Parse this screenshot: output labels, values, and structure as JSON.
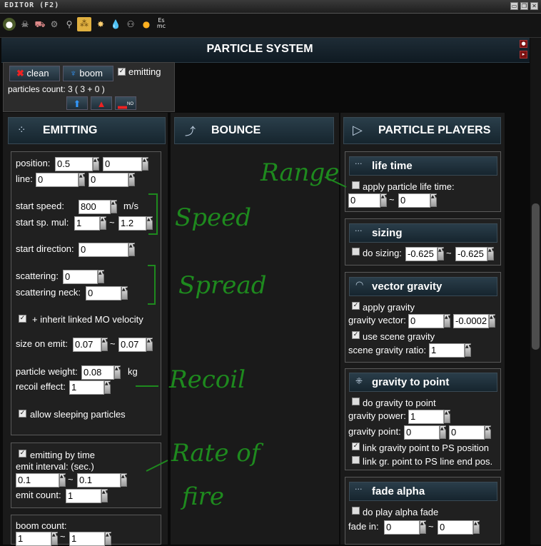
{
  "window": {
    "title": "EDITOR (F2)",
    "icons": [
      "minimize-icon",
      "restore-icon",
      "close-icon"
    ]
  },
  "toolbar": {
    "tools": [
      "globe-icon",
      "skull-icon",
      "vehicle-icon",
      "gear-icon",
      "joint-icon",
      "particle-icon",
      "explosion-icon",
      "water-drop-icon",
      "people-icon",
      "sun-icon",
      "script-icon"
    ],
    "selected": "particle-icon",
    "script_label": "Es\nmc"
  },
  "header": {
    "title": "PARTICLE SYSTEM"
  },
  "controls": {
    "clean_label": "clean",
    "boom_label": "boom",
    "emitting_label": "emitting",
    "emitting_checked": true,
    "count_label": "particles count: 3 ( 3 + 0 )",
    "small_buttons": [
      "save-icon",
      "load-icon",
      "reset-icon"
    ],
    "reset_badge": "NO"
  },
  "emitting": {
    "title": "EMITTING",
    "position_label": "position:",
    "position": [
      "0.5",
      "0"
    ],
    "line_label": "line:",
    "line": [
      "0",
      "0"
    ],
    "start_speed_label": "start speed:",
    "start_speed": "800",
    "speed_unit": "m/s",
    "start_sp_mul_label": "start sp. mul:",
    "start_sp_mul": [
      "1",
      "1.2"
    ],
    "start_direction_label": "start direction:",
    "start_direction": "0",
    "scattering_label": "scattering:",
    "scattering": "0",
    "scattering_neck_label": "scattering neck:",
    "scattering_neck": "0",
    "inherit_label": "+ inherit linked MO velocity",
    "inherit_checked": true,
    "size_on_emit_label": "size on emit:",
    "size_on_emit": [
      "0.07",
      "0.07"
    ],
    "particle_weight_label": "particle weight:",
    "particle_weight": "0.08",
    "weight_unit": "kg",
    "recoil_effect_label": "recoil effect:",
    "recoil_effect": "1",
    "allow_sleeping_label": "allow sleeping particles",
    "allow_sleeping_checked": true,
    "emitting_by_time_label": "emitting by time",
    "emitting_by_time_checked": true,
    "emit_interval_label": "emit interval: (sec.)",
    "emit_interval": [
      "0.1",
      "0.1"
    ],
    "emit_count_label": "emit count:",
    "emit_count": "1",
    "boom_count_label": "boom count:",
    "boom_count": [
      "1",
      "1"
    ]
  },
  "bounce": {
    "title": "BOUNCE"
  },
  "players": {
    "title": "PARTICLE PLAYERS",
    "life_time": {
      "title": "life time",
      "apply_label": "apply particle life time:",
      "apply_checked": false,
      "range": [
        "0",
        "0"
      ]
    },
    "sizing": {
      "title": "sizing",
      "do_label": "do sizing:",
      "do_checked": false,
      "range": [
        "-0.625",
        "-0.625"
      ]
    },
    "vector_gravity": {
      "title": "vector gravity",
      "apply_label": "apply gravity",
      "apply_checked": true,
      "vector_label": "gravity vector:",
      "vector": [
        "0",
        "-0.0002"
      ],
      "use_scene_label": "use scene gravity",
      "use_scene_checked": true,
      "ratio_label": "scene gravity ratio:",
      "ratio": "1"
    },
    "gravity_to_point": {
      "title": "gravity to point",
      "do_label": "do gravity to point",
      "do_checked": false,
      "power_label": "gravity power:",
      "power": "1",
      "point_label": "gravity point:",
      "point": [
        "0",
        "0"
      ],
      "link_ps_label": "link gravity point to PS position",
      "link_ps_checked": true,
      "link_line_label": "link gr. point to PS line end pos.",
      "link_line_checked": false
    },
    "fade_alpha": {
      "title": "fade alpha",
      "do_label": "do play alpha fade",
      "do_checked": false,
      "fade_in_label": "fade in:",
      "fade_in": [
        "0",
        "0"
      ]
    }
  },
  "annotations": {
    "range": "Range",
    "speed": "Speed",
    "spread": "Spread",
    "recoil": "Recoil",
    "rate_of_fire_1": "Rate of",
    "rate_of_fire_2": "fire"
  },
  "colors": {
    "accent": "#e0b040",
    "header": "#1e2c36",
    "annotation": "#1e8a1e"
  }
}
